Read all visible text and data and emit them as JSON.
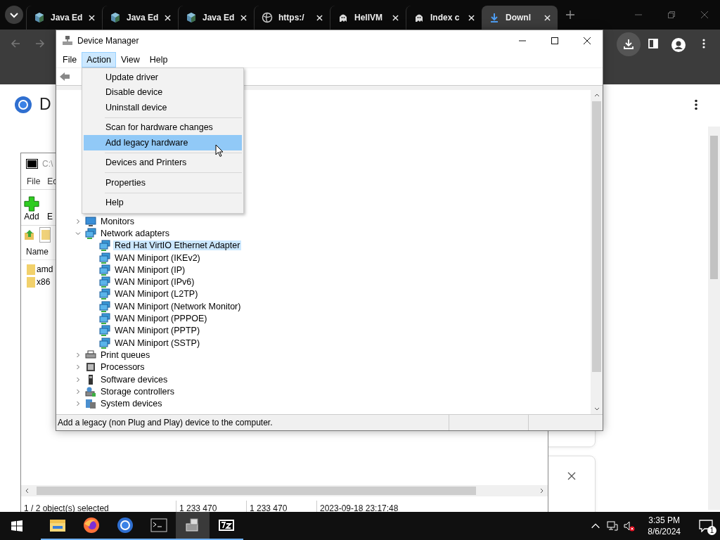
{
  "browser": {
    "tabs": [
      {
        "title": "Java Ed",
        "kind": "cube",
        "selected": false
      },
      {
        "title": "Java Ed",
        "kind": "cube",
        "selected": false
      },
      {
        "title": "Java Ed",
        "kind": "cube",
        "selected": false
      },
      {
        "title": "https:/",
        "kind": "globe",
        "selected": false
      },
      {
        "title": "HellVM",
        "kind": "ghost",
        "selected": false
      },
      {
        "title": "Index c",
        "kind": "ghost",
        "selected": false
      },
      {
        "title": "Downl",
        "kind": "download",
        "selected": true
      }
    ],
    "page": {
      "heading": "D"
    }
  },
  "seven_zip": {
    "title": "C:\\",
    "menu": [
      "File",
      "Ec"
    ],
    "toolbar": [
      "Add",
      "E"
    ],
    "columns": [
      "Name"
    ],
    "files": [
      "amd",
      "x86"
    ],
    "status": [
      "1 / 2 object(s) selected",
      "1 233 470",
      "1 233 470",
      "2023-09-18 23:17:48"
    ]
  },
  "device_manager": {
    "title": "Device Manager",
    "menu": [
      {
        "label": "File",
        "selected": false
      },
      {
        "label": "Action",
        "selected": true
      },
      {
        "label": "View",
        "selected": false
      },
      {
        "label": "Help",
        "selected": false
      }
    ],
    "action_menu": [
      {
        "kind": "item",
        "label": "Update driver",
        "selected": false
      },
      {
        "kind": "item",
        "label": "Disable device",
        "selected": false
      },
      {
        "kind": "item",
        "label": "Uninstall device",
        "selected": false
      },
      {
        "kind": "separator"
      },
      {
        "kind": "item",
        "label": "Scan for hardware changes",
        "selected": false
      },
      {
        "kind": "item",
        "label": "Add legacy hardware",
        "selected": true
      },
      {
        "kind": "separator"
      },
      {
        "kind": "item",
        "label": "Devices and Printers",
        "selected": false
      },
      {
        "kind": "separator"
      },
      {
        "kind": "item",
        "label": "Properties",
        "selected": false
      },
      {
        "kind": "separator"
      },
      {
        "kind": "item",
        "label": "Help",
        "selected": false
      }
    ],
    "tree": [
      {
        "label": "Monitors",
        "kind": "monitor",
        "expanded": false,
        "selected": false
      },
      {
        "label": "Network adapters",
        "kind": "network",
        "expanded": true,
        "selected": false,
        "children": [
          {
            "label": "Red Hat VirtIO Ethernet Adapter",
            "kind": "network",
            "selected": true
          },
          {
            "label": "WAN Miniport (IKEv2)",
            "kind": "network",
            "selected": false
          },
          {
            "label": "WAN Miniport (IP)",
            "kind": "network",
            "selected": false
          },
          {
            "label": "WAN Miniport (IPv6)",
            "kind": "network",
            "selected": false
          },
          {
            "label": "WAN Miniport (L2TP)",
            "kind": "network",
            "selected": false
          },
          {
            "label": "WAN Miniport (Network Monitor)",
            "kind": "network",
            "selected": false
          },
          {
            "label": "WAN Miniport (PPPOE)",
            "kind": "network",
            "selected": false
          },
          {
            "label": "WAN Miniport (PPTP)",
            "kind": "network",
            "selected": false
          },
          {
            "label": "WAN Miniport (SSTP)",
            "kind": "network",
            "selected": false
          }
        ]
      },
      {
        "label": "Print queues",
        "kind": "printer",
        "expanded": false,
        "selected": false
      },
      {
        "label": "Processors",
        "kind": "cpu",
        "expanded": false,
        "selected": false
      },
      {
        "label": "Software devices",
        "kind": "software",
        "expanded": false,
        "selected": false
      },
      {
        "label": "Storage controllers",
        "kind": "storage",
        "expanded": false,
        "selected": false
      },
      {
        "label": "System devices",
        "kind": "system",
        "expanded": false,
        "selected": false
      }
    ],
    "status_bar": "Add a legacy (non Plug and Play) device to the computer."
  },
  "taskbar": {
    "apps": [
      {
        "kind": "explorer",
        "selected": false
      },
      {
        "kind": "firefox",
        "selected": false
      },
      {
        "kind": "chrome",
        "selected": false
      },
      {
        "kind": "terminal",
        "selected": false
      },
      {
        "kind": "devmgr",
        "selected": true
      },
      {
        "kind": "sevenzip",
        "selected": false
      }
    ],
    "clock": {
      "time": "3:35 PM",
      "date": "8/6/2024"
    },
    "notifications": "1"
  }
}
